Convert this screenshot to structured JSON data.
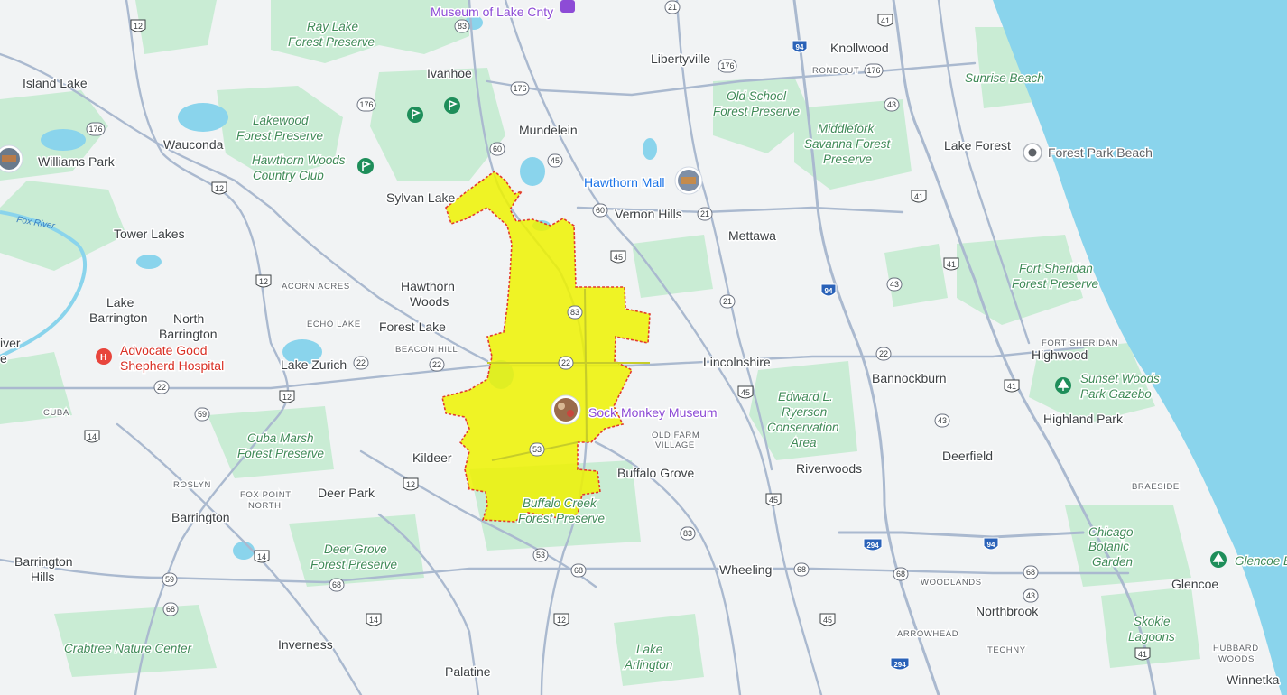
{
  "colors": {
    "land": "#f1f3f4",
    "park": "#c9ecd4",
    "lake": "#8ad4ec",
    "road": "#aab9cf",
    "highlight_fill": "#eef200",
    "highlight_stroke": "#e23b2e"
  },
  "water": {
    "river_label": "Fox River"
  },
  "towns": [
    {
      "id": "island-lake",
      "text": "Island Lake"
    },
    {
      "id": "williams-park",
      "text": "Williams Park"
    },
    {
      "id": "wauconda",
      "text": "Wauconda"
    },
    {
      "id": "tower-lakes",
      "text": "Tower Lakes"
    },
    {
      "id": "lake-barrington-1",
      "text": "Lake"
    },
    {
      "id": "lake-barrington-2",
      "text": "Barrington"
    },
    {
      "id": "north-barrington-1",
      "text": "North"
    },
    {
      "id": "north-barrington-2",
      "text": "Barrington"
    },
    {
      "id": "lake-zurich",
      "text": "Lake Zurich"
    },
    {
      "id": "ivanhoe",
      "text": "Ivanhoe"
    },
    {
      "id": "mundelein",
      "text": "Mundelein"
    },
    {
      "id": "sylvan-lake",
      "text": "Sylvan Lake"
    },
    {
      "id": "libertyville",
      "text": "Libertyville"
    },
    {
      "id": "vernon-hills",
      "text": "Vernon Hills"
    },
    {
      "id": "mettawa",
      "text": "Mettawa"
    },
    {
      "id": "knollwood",
      "text": "Knollwood"
    },
    {
      "id": "lake-forest",
      "text": "Lake Forest"
    },
    {
      "id": "hawthorn-woods-1",
      "text": "Hawthorn"
    },
    {
      "id": "hawthorn-woods-2",
      "text": "Woods"
    },
    {
      "id": "forest-lake",
      "text": "Forest Lake"
    },
    {
      "id": "lincolnshire",
      "text": "Lincolnshire"
    },
    {
      "id": "bannockburn",
      "text": "Bannockburn"
    },
    {
      "id": "highwood",
      "text": "Highwood"
    },
    {
      "id": "highland-park",
      "text": "Highland Park"
    },
    {
      "id": "kildeer",
      "text": "Kildeer"
    },
    {
      "id": "deer-park",
      "text": "Deer Park"
    },
    {
      "id": "barrington",
      "text": "Barrington"
    },
    {
      "id": "buffalo-grove",
      "text": "Buffalo Grove"
    },
    {
      "id": "riverwoods",
      "text": "Riverwoods"
    },
    {
      "id": "deerfield",
      "text": "Deerfield"
    },
    {
      "id": "wheeling",
      "text": "Wheeling"
    },
    {
      "id": "barrington-hills-1",
      "text": "Barrington"
    },
    {
      "id": "barrington-hills-2",
      "text": "Hills"
    },
    {
      "id": "inverness",
      "text": "Inverness"
    },
    {
      "id": "palatine",
      "text": "Palatine"
    },
    {
      "id": "northbrook",
      "text": "Northbrook"
    },
    {
      "id": "glencoe",
      "text": "Glencoe"
    },
    {
      "id": "winnetka",
      "text": "Winnetka"
    },
    {
      "id": "river-partial-1",
      "text": "iver"
    },
    {
      "id": "river-partial-2",
      "text": "e"
    }
  ],
  "small_labels": [
    {
      "id": "acorn-acres",
      "text": "ACORN ACRES"
    },
    {
      "id": "echo-lake",
      "text": "ECHO LAKE"
    },
    {
      "id": "beacon-hill",
      "text": "BEACON HILL"
    },
    {
      "id": "cuba",
      "text": "CUBA"
    },
    {
      "id": "roslyn",
      "text": "ROSLYN"
    },
    {
      "id": "fox-point-1",
      "text": "FOX POINT"
    },
    {
      "id": "fox-point-2",
      "text": "NORTH"
    },
    {
      "id": "old-farm-1",
      "text": "OLD FARM"
    },
    {
      "id": "old-farm-2",
      "text": "VILLAGE"
    },
    {
      "id": "rondout",
      "text": "RONDOUT"
    },
    {
      "id": "fort-sheridan",
      "text": "FORT SHERIDAN"
    },
    {
      "id": "braeside",
      "text": "BRAESIDE"
    },
    {
      "id": "woodlands",
      "text": "WOODLANDS"
    },
    {
      "id": "arrowhead",
      "text": "ARROWHEAD"
    },
    {
      "id": "techny",
      "text": "TECHNY"
    },
    {
      "id": "hubbard-woods-1",
      "text": "HUBBARD"
    },
    {
      "id": "hubbard-woods-2",
      "text": "WOODS"
    }
  ],
  "parks": [
    {
      "id": "ray-lake-1",
      "text": "Ray Lake"
    },
    {
      "id": "ray-lake-2",
      "text": "Forest Preserve"
    },
    {
      "id": "lakewood-1",
      "text": "Lakewood"
    },
    {
      "id": "lakewood-2",
      "text": "Forest Preserve"
    },
    {
      "id": "old-school-1",
      "text": "Old School"
    },
    {
      "id": "old-school-2",
      "text": "Forest Preserve"
    },
    {
      "id": "middlefork-1",
      "text": "Middlefork"
    },
    {
      "id": "middlefork-2",
      "text": "Savanna Forest"
    },
    {
      "id": "middlefork-3",
      "text": "Preserve"
    },
    {
      "id": "sunrise-beach",
      "text": "Sunrise Beach"
    },
    {
      "id": "fort-sheridan-fp-1",
      "text": "Fort Sheridan"
    },
    {
      "id": "fort-sheridan-fp-2",
      "text": "Forest Preserve"
    },
    {
      "id": "sunset-woods-1",
      "text": "Sunset Woods"
    },
    {
      "id": "sunset-woods-2",
      "text": "Park Gazebo"
    },
    {
      "id": "edward-ryerson-1",
      "text": "Edward L."
    },
    {
      "id": "edward-ryerson-2",
      "text": "Ryerson"
    },
    {
      "id": "edward-ryerson-3",
      "text": "Conservation"
    },
    {
      "id": "edward-ryerson-4",
      "text": "Area"
    },
    {
      "id": "cuba-marsh-1",
      "text": "Cuba Marsh"
    },
    {
      "id": "cuba-marsh-2",
      "text": "Forest Preserve"
    },
    {
      "id": "buffalo-creek-1",
      "text": "Buffalo Creek"
    },
    {
      "id": "buffalo-creek-2",
      "text": "Forest Preserve"
    },
    {
      "id": "deer-grove-1",
      "text": "Deer Grove"
    },
    {
      "id": "deer-grove-2",
      "text": "Forest Preserve"
    },
    {
      "id": "chicago-botanic-1",
      "text": "Chicago"
    },
    {
      "id": "chicago-botanic-2",
      "text": "Botanic"
    },
    {
      "id": "chicago-botanic-3",
      "text": "Garden"
    },
    {
      "id": "skokie-lagoons-1",
      "text": "Skokie"
    },
    {
      "id": "skokie-lagoons-2",
      "text": "Lagoons"
    },
    {
      "id": "lake-arlington-1",
      "text": "Lake"
    },
    {
      "id": "lake-arlington-2",
      "text": "Arlington"
    },
    {
      "id": "crabtree",
      "text": "Crabtree Nature Center"
    },
    {
      "id": "hawthorn-cc-1",
      "text": "Hawthorn Woods"
    },
    {
      "id": "hawthorn-cc-2",
      "text": "Country Club"
    },
    {
      "id": "glencoe-beach",
      "text": "Glencoe B"
    }
  ],
  "pois": {
    "museum_lake_county": "Museum of Lake Cnty",
    "hawthorn_mall": "Hawthorn Mall",
    "sock_monkey_1": "Sock",
    "sock_monkey_2": "Monkey Museum",
    "advocate_1": "Advocate Good",
    "advocate_2": "Shepherd Hospital",
    "forest_park_beach": "Forest Park Beach"
  },
  "shields": [
    {
      "id": "us12-a",
      "kind": "us",
      "num": "12"
    },
    {
      "id": "us12-b",
      "kind": "us",
      "num": "12"
    },
    {
      "id": "us12-c",
      "kind": "us",
      "num": "12"
    },
    {
      "id": "us12-d",
      "kind": "us",
      "num": "12"
    },
    {
      "id": "us12-e",
      "kind": "us",
      "num": "12"
    },
    {
      "id": "us12-f",
      "kind": "us",
      "num": "12"
    },
    {
      "id": "il83-a",
      "kind": "state",
      "num": "83"
    },
    {
      "id": "il83-b",
      "kind": "state",
      "num": "83"
    },
    {
      "id": "il83-c",
      "kind": "state",
      "num": "83"
    },
    {
      "id": "il176-a",
      "kind": "state",
      "num": "176"
    },
    {
      "id": "il176-b",
      "kind": "state",
      "num": "176"
    },
    {
      "id": "il176-c",
      "kind": "state",
      "num": "176"
    },
    {
      "id": "il176-d",
      "kind": "state",
      "num": "176"
    },
    {
      "id": "il176-e",
      "kind": "state",
      "num": "176"
    },
    {
      "id": "i94-a",
      "kind": "interstate",
      "num": "94"
    },
    {
      "id": "i94-b",
      "kind": "interstate",
      "num": "94"
    },
    {
      "id": "i94-c",
      "kind": "interstate",
      "num": "94"
    },
    {
      "id": "i294-a",
      "kind": "interstate",
      "num": "294"
    },
    {
      "id": "i294-b",
      "kind": "interstate",
      "num": "294"
    },
    {
      "id": "us41-a",
      "kind": "us",
      "num": "41"
    },
    {
      "id": "us41-b",
      "kind": "us",
      "num": "41"
    },
    {
      "id": "us41-c",
      "kind": "us",
      "num": "41"
    },
    {
      "id": "us41-d",
      "kind": "us",
      "num": "41"
    },
    {
      "id": "us41-e",
      "kind": "us",
      "num": "41"
    },
    {
      "id": "il43-a",
      "kind": "state",
      "num": "43"
    },
    {
      "id": "il43-b",
      "kind": "state",
      "num": "43"
    },
    {
      "id": "il43-c",
      "kind": "state",
      "num": "43"
    },
    {
      "id": "il43-d",
      "kind": "state",
      "num": "43"
    },
    {
      "id": "il43-e",
      "kind": "state",
      "num": "43"
    },
    {
      "id": "il21-a",
      "kind": "state",
      "num": "21"
    },
    {
      "id": "il21-b",
      "kind": "state",
      "num": "21"
    },
    {
      "id": "il21-c",
      "kind": "state",
      "num": "21"
    },
    {
      "id": "il60-a",
      "kind": "state",
      "num": "60"
    },
    {
      "id": "il60-b",
      "kind": "state",
      "num": "60"
    },
    {
      "id": "il45-a",
      "kind": "state",
      "num": "45"
    },
    {
      "id": "us45-a",
      "kind": "us",
      "num": "45"
    },
    {
      "id": "us45-b",
      "kind": "us",
      "num": "45"
    },
    {
      "id": "us45-c",
      "kind": "us",
      "num": "45"
    },
    {
      "id": "us45-d",
      "kind": "us",
      "num": "45"
    },
    {
      "id": "il22-a",
      "kind": "state",
      "num": "22"
    },
    {
      "id": "il22-b",
      "kind": "state",
      "num": "22"
    },
    {
      "id": "il22-c",
      "kind": "state",
      "num": "22"
    },
    {
      "id": "il22-d",
      "kind": "state",
      "num": "22"
    },
    {
      "id": "il22-e",
      "kind": "state",
      "num": "22"
    },
    {
      "id": "il59-a",
      "kind": "state",
      "num": "59"
    },
    {
      "id": "il59-b",
      "kind": "state",
      "num": "59"
    },
    {
      "id": "us14-a",
      "kind": "us",
      "num": "14"
    },
    {
      "id": "us14-b",
      "kind": "us",
      "num": "14"
    },
    {
      "id": "us14-c",
      "kind": "us",
      "num": "14"
    },
    {
      "id": "il53-a",
      "kind": "state",
      "num": "53"
    },
    {
      "id": "il53-b",
      "kind": "state",
      "num": "53"
    },
    {
      "id": "il68-a",
      "kind": "state",
      "num": "68"
    },
    {
      "id": "il68-b",
      "kind": "state",
      "num": "68"
    },
    {
      "id": "il68-c",
      "kind": "state",
      "num": "68"
    },
    {
      "id": "il68-d",
      "kind": "state",
      "num": "68"
    },
    {
      "id": "il68-e",
      "kind": "state",
      "num": "68"
    },
    {
      "id": "il68-f",
      "kind": "state",
      "num": "68"
    },
    {
      "id": "il83-d",
      "kind": "state",
      "num": "83"
    }
  ]
}
